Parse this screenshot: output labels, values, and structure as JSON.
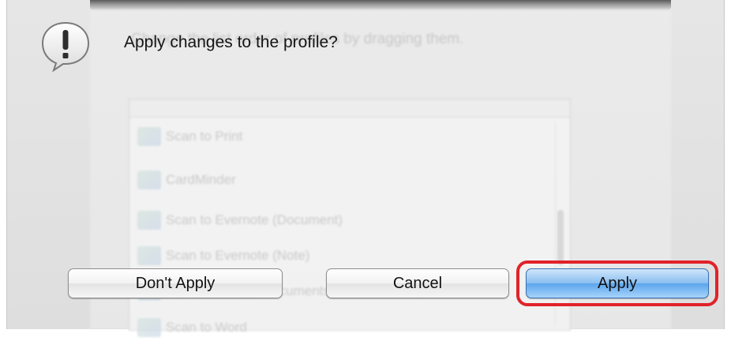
{
  "dialog": {
    "message": "Apply changes to the profile?",
    "icon": "alert-exclamation-icon"
  },
  "buttons": {
    "dont_apply": "Don't Apply",
    "cancel": "Cancel",
    "apply": "Apply"
  },
  "background_window": {
    "instruction": "Change the list order of profiles by dragging them.",
    "profiles": [
      {
        "label": "Scan to Print",
        "icon": "printer-icon"
      },
      {
        "label": "CardMinder",
        "icon": "card-icon"
      },
      {
        "label": "Scan to Evernote (Document)",
        "icon": "evernote-document-icon"
      },
      {
        "label": "Scan to Evernote (Note)",
        "icon": "evernote-note-icon"
      },
      {
        "label": "Scan to Google Documents",
        "icon": "google-docs-icon"
      },
      {
        "label": "Scan to Word",
        "icon": "word-icon"
      }
    ]
  },
  "colors": {
    "highlight": "#e1222a",
    "default_button": "#5da6ec"
  }
}
